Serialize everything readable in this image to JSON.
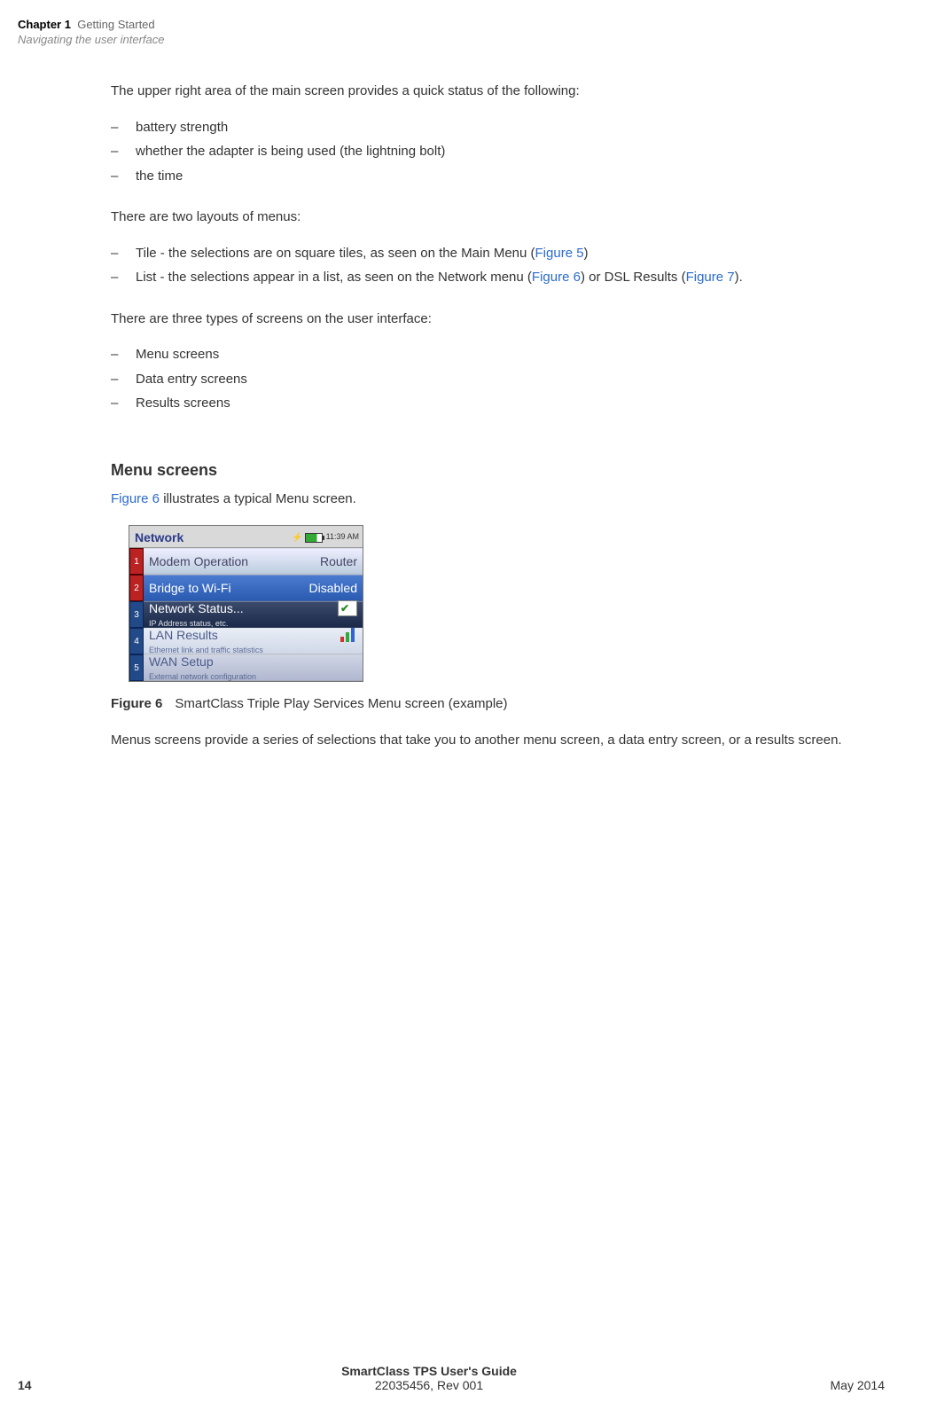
{
  "header": {
    "chapter_label": "Chapter 1",
    "chapter_title": "Getting Started",
    "subtitle": "Navigating the user interface"
  },
  "body": {
    "p1": "The upper right area of the main screen provides a quick status of the following:",
    "status_items": [
      "battery strength",
      "whether the adapter is being used (the lightning bolt)",
      "the time"
    ],
    "p2": "There are two layouts of menus:",
    "layout_items": {
      "tile_pre": "Tile - the selections are on square tiles, as seen on the Main Menu (",
      "tile_link": "Figure 5",
      "tile_post": ")",
      "list_pre": "List - the selections appear in a list, as seen on the Network menu (",
      "list_link1": "Figure 6",
      "list_mid": ") or DSL Results (",
      "list_link2": "Figure 7",
      "list_post": ")."
    },
    "p3": "There are three types of screens on the user interface:",
    "screen_types": [
      "Menu screens",
      "Data entry screens",
      "Results screens"
    ],
    "menu_heading": "Menu screens",
    "menu_intro_link": "Figure 6",
    "menu_intro_rest": " illustrates a typical Menu screen.",
    "figure_caption_label": "Figure 6",
    "figure_caption_text": "SmartClass Triple Play Services Menu screen (example)",
    "p4": "Menus screens provide a series of selections that take you to another menu screen, a data entry screen, or a results screen."
  },
  "device": {
    "title": "Network",
    "time": "11:39 AM",
    "rows": [
      {
        "num": "1",
        "label": "Modem Operation",
        "value": "Router",
        "sub": "",
        "style": "row-gray",
        "num_style": "",
        "icon": "none"
      },
      {
        "num": "2",
        "label": "Bridge to Wi-Fi",
        "value": "Disabled",
        "sub": "",
        "style": "row-blue",
        "num_style": "",
        "icon": "none"
      },
      {
        "num": "3",
        "label": "Network Status...",
        "value": "",
        "sub": "IP Address status, etc.",
        "style": "row-dark",
        "num_style": "blue",
        "icon": "check"
      },
      {
        "num": "4",
        "label": "LAN Results",
        "value": "",
        "sub": "Ethernet link and traffic statistics",
        "style": "row-light",
        "num_style": "blue",
        "icon": "bars"
      },
      {
        "num": "5",
        "label": "WAN Setup",
        "value": "",
        "sub": "External network configuration",
        "style": "row-gray2",
        "num_style": "blue",
        "icon": "none"
      }
    ]
  },
  "footer": {
    "page": "14",
    "title": "SmartClass TPS User's Guide",
    "doc": "22035456, Rev 001",
    "date": "May 2014"
  },
  "colors": {
    "link": "#2a6bcc"
  }
}
